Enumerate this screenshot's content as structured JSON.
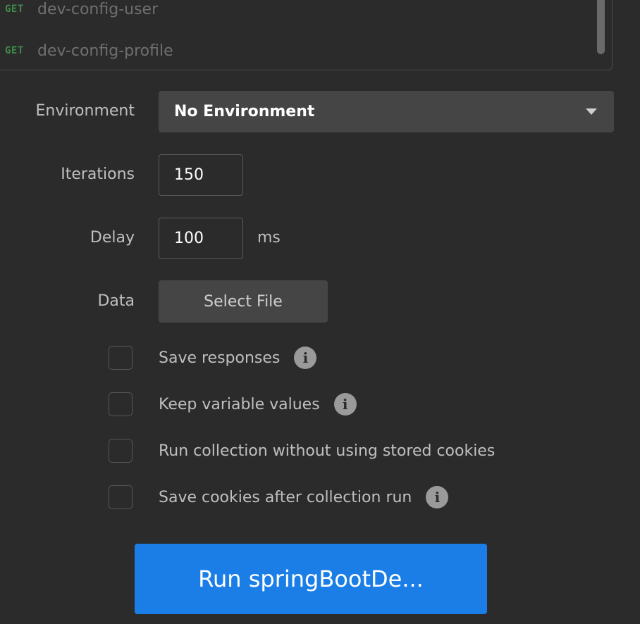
{
  "requests": [
    {
      "method": "GET",
      "name": "dev-config-user"
    },
    {
      "method": "GET",
      "name": "dev-config-profile"
    }
  ],
  "environment": {
    "label": "Environment",
    "value": "No Environment"
  },
  "iterations": {
    "label": "Iterations",
    "value": "150"
  },
  "delay": {
    "label": "Delay",
    "value": "100",
    "unit": "ms"
  },
  "data": {
    "label": "Data",
    "button": "Select File"
  },
  "options": [
    {
      "label": "Save responses",
      "checked": false,
      "info": true
    },
    {
      "label": "Keep variable values",
      "checked": false,
      "info": true
    },
    {
      "label": "Run collection without using stored cookies",
      "checked": false,
      "info": false
    },
    {
      "label": "Save cookies after collection run",
      "checked": false,
      "info": true
    }
  ],
  "run_button": "Run springBootDe...",
  "colors": {
    "accent": "#1a7ee6",
    "get_method": "#3f8a4b",
    "background": "#2b2b2b"
  }
}
